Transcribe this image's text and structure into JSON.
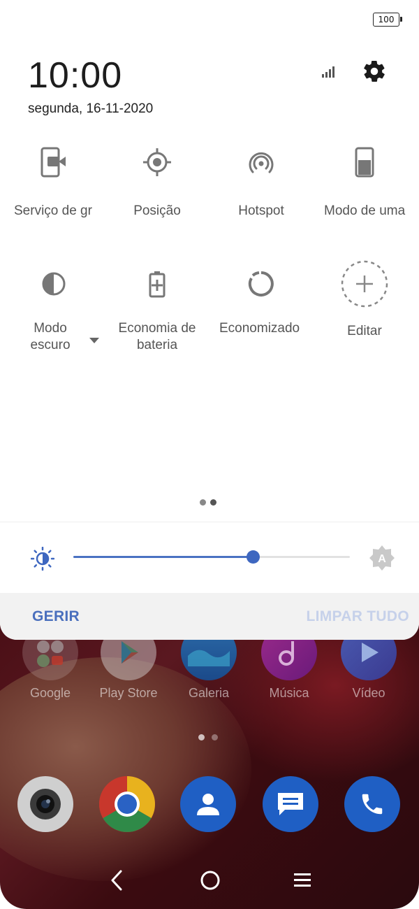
{
  "status_bar": {
    "battery": "100"
  },
  "header": {
    "time": "10:00",
    "date": "segunda, 16-11-2020"
  },
  "tiles": [
    {
      "label": "Serviço de gr",
      "icon": "screen-record-icon"
    },
    {
      "label": "Posição",
      "icon": "location-icon"
    },
    {
      "label": "Hotspot",
      "icon": "hotspot-icon"
    },
    {
      "label": "Modo de uma",
      "icon": "one-hand-mode-icon"
    },
    {
      "label": "Modo escuro",
      "icon": "dark-mode-icon"
    },
    {
      "label": "Economia de bateria",
      "icon": "battery-saver-icon"
    },
    {
      "label": "Economizado",
      "icon": "data-saver-icon"
    },
    {
      "label": "Editar",
      "icon": "add-icon"
    }
  ],
  "brightness": {
    "level_percent": 65
  },
  "actions": {
    "manage": "GERIR",
    "clear_all": "LIMPAR TUDO"
  },
  "home_apps": [
    {
      "label": "Google"
    },
    {
      "label": "Play Store"
    },
    {
      "label": "Galeria"
    },
    {
      "label": "Música"
    },
    {
      "label": "Vídeo"
    }
  ],
  "colors": {
    "accent": "#4a72c2",
    "clear_all_disabled": "#c6d1ea"
  }
}
